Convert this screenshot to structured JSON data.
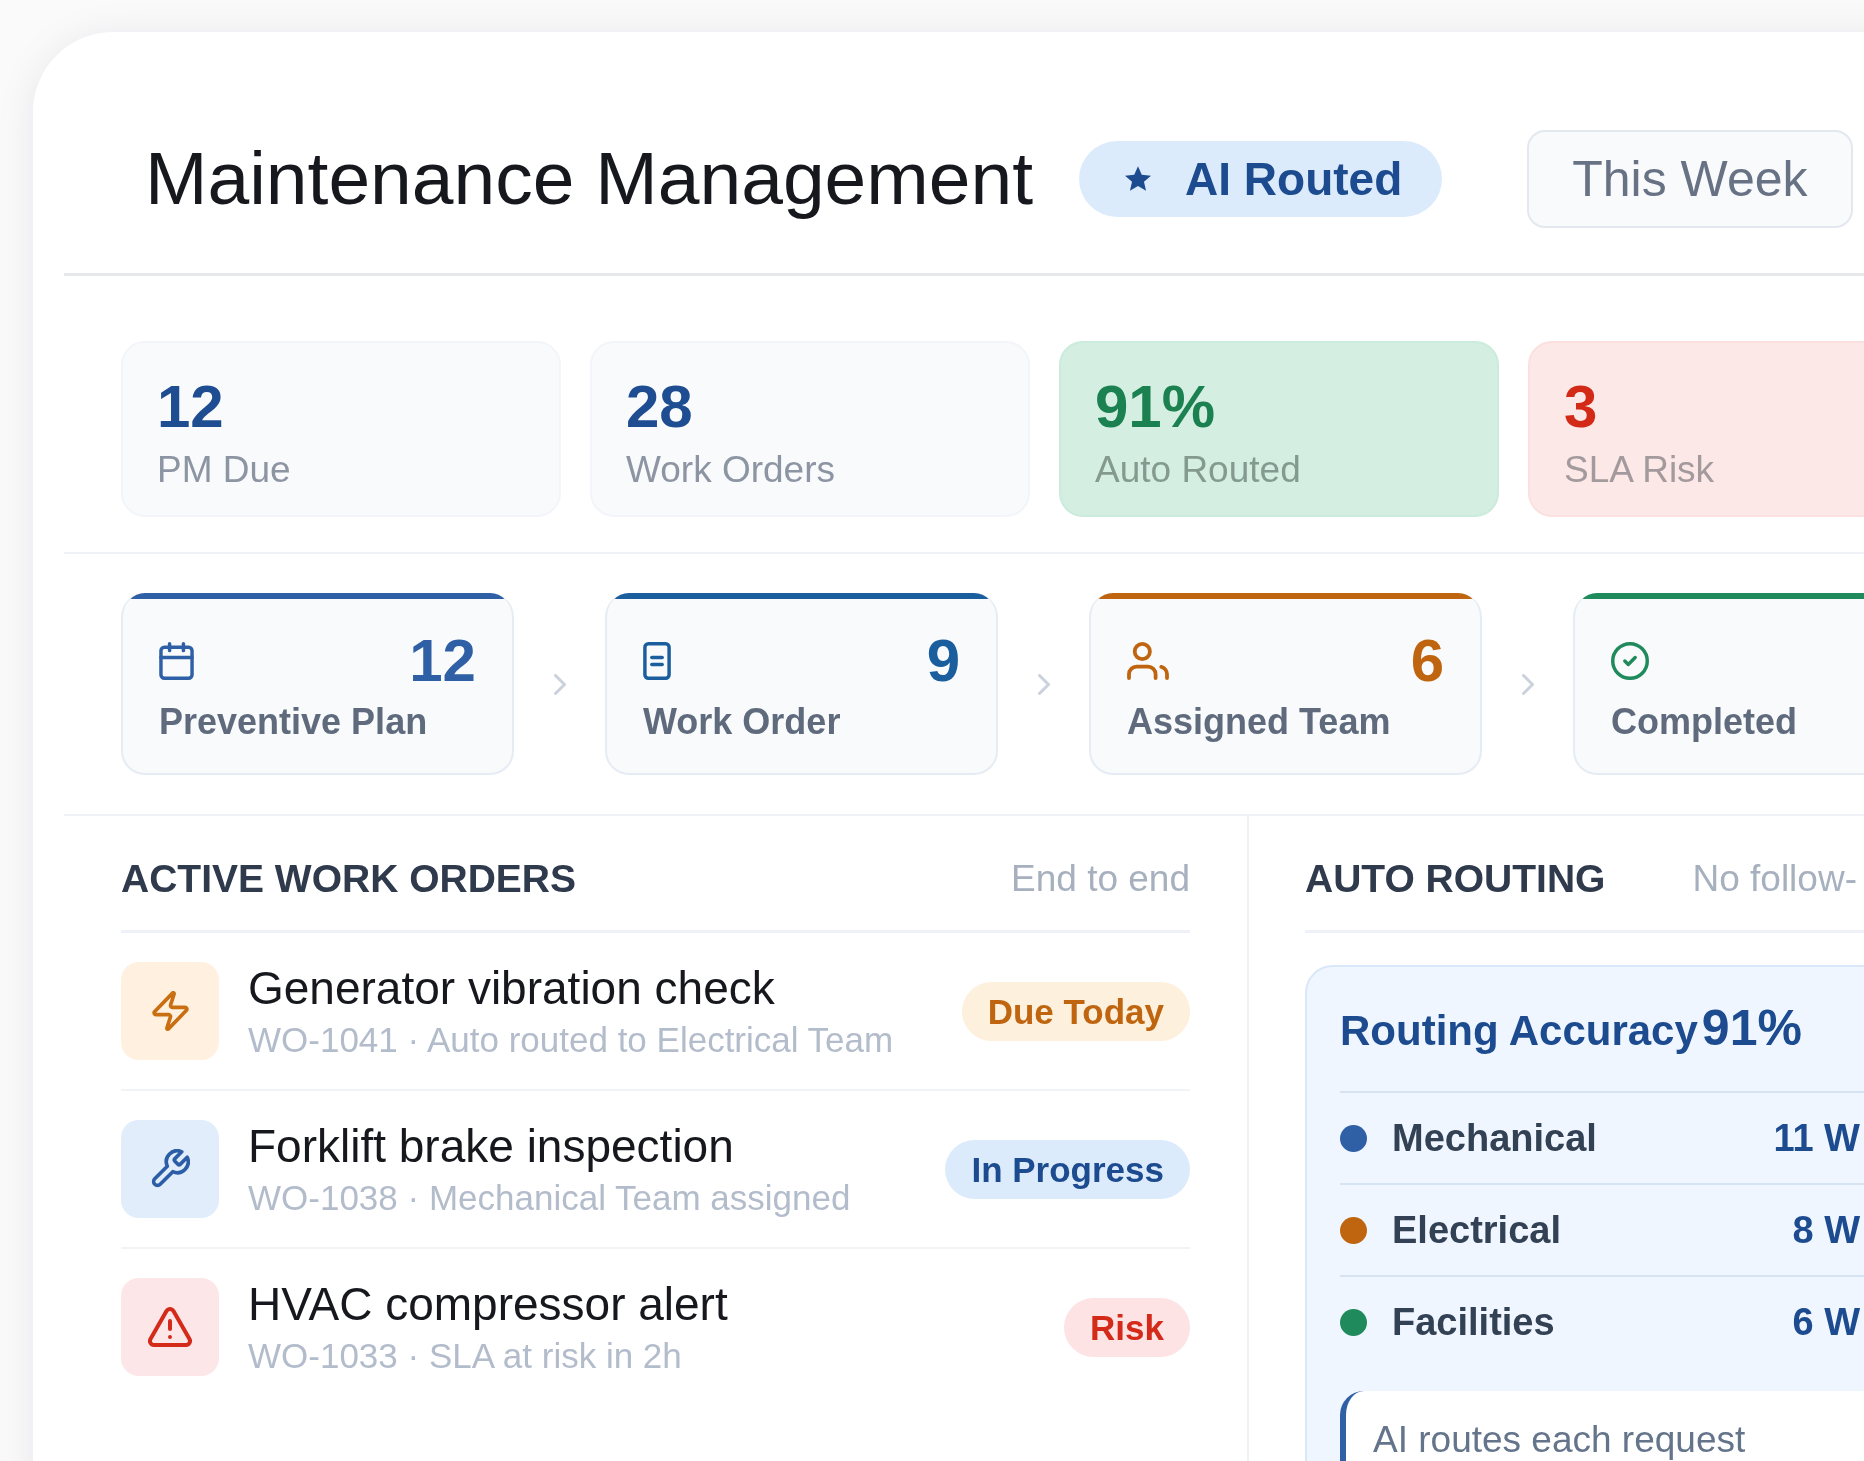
{
  "header": {
    "title": "Maintenance Management",
    "badge": "AI Routed",
    "period": "This Week"
  },
  "stats": [
    {
      "value": "12",
      "label": "PM Due",
      "kind": "neutral"
    },
    {
      "value": "28",
      "label": "Work Orders",
      "kind": "neutral"
    },
    {
      "value": "91%",
      "label": "Auto Routed",
      "kind": "success"
    },
    {
      "value": "3",
      "label": "SLA Risk",
      "kind": "danger"
    }
  ],
  "pipeline": [
    {
      "kind": "plan",
      "label": "Preventive Plan",
      "count": "12",
      "color": "#2f5fa5"
    },
    {
      "kind": "order",
      "label": "Work Order",
      "count": "9",
      "color": "#1b5e9e"
    },
    {
      "kind": "team",
      "label": "Assigned Team",
      "count": "6",
      "color": "#c0650f"
    },
    {
      "kind": "done",
      "label": "Completed",
      "color": "#1f8a5b"
    }
  ],
  "work_orders": {
    "title": "ACTIVE WORK ORDERS",
    "note": "End to end",
    "items": [
      {
        "kind": "warning",
        "title": "Generator vibration check",
        "detail": "WO-1041 · Auto routed to Electrical Team",
        "status": "Due Today"
      },
      {
        "kind": "info",
        "title": "Forklift brake inspection",
        "detail": "WO-1038 · Mechanical Team assigned",
        "status": "In Progress"
      },
      {
        "kind": "danger",
        "title": "HVAC compressor alert",
        "detail": "WO-1033 · SLA at risk in 2h",
        "status": "Risk"
      }
    ]
  },
  "auto_routing": {
    "title": "AUTO ROUTING",
    "note": "No follow-",
    "accuracy_label": "Routing Accuracy",
    "accuracy_value": "91%",
    "teams": [
      {
        "name": "Mechanical",
        "count": "11 W",
        "color": "#2f5fa5"
      },
      {
        "name": "Electrical",
        "count": "8 W",
        "color": "#c0650f"
      },
      {
        "name": "Facilities",
        "count": "6 W",
        "color": "#1f8a5b"
      }
    ],
    "callout": "AI routes each request"
  }
}
